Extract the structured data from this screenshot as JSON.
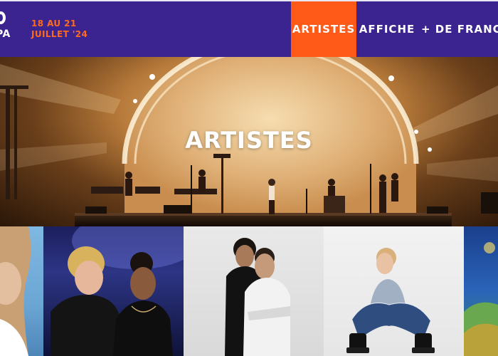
{
  "header": {
    "logo_text": "PA",
    "dates_line1": "18 AU 21",
    "dates_line2": "JUILLET '24",
    "nav": [
      {
        "label": "ARTISTES",
        "active": true
      },
      {
        "label": "AFFICHE",
        "active": false
      },
      {
        "label": "+ DE FRANCOS",
        "active": false
      }
    ]
  },
  "hero": {
    "title": "ARTISTES"
  },
  "cards": [
    {
      "name": "artist-card-1"
    },
    {
      "name": "artist-card-2"
    },
    {
      "name": "artist-card-3"
    },
    {
      "name": "artist-card-4"
    },
    {
      "name": "artist-card-5"
    }
  ],
  "colors": {
    "brand_purple": "#3b2490",
    "accent_orange": "#ff5a17",
    "date_orange": "#ff6a1b"
  }
}
